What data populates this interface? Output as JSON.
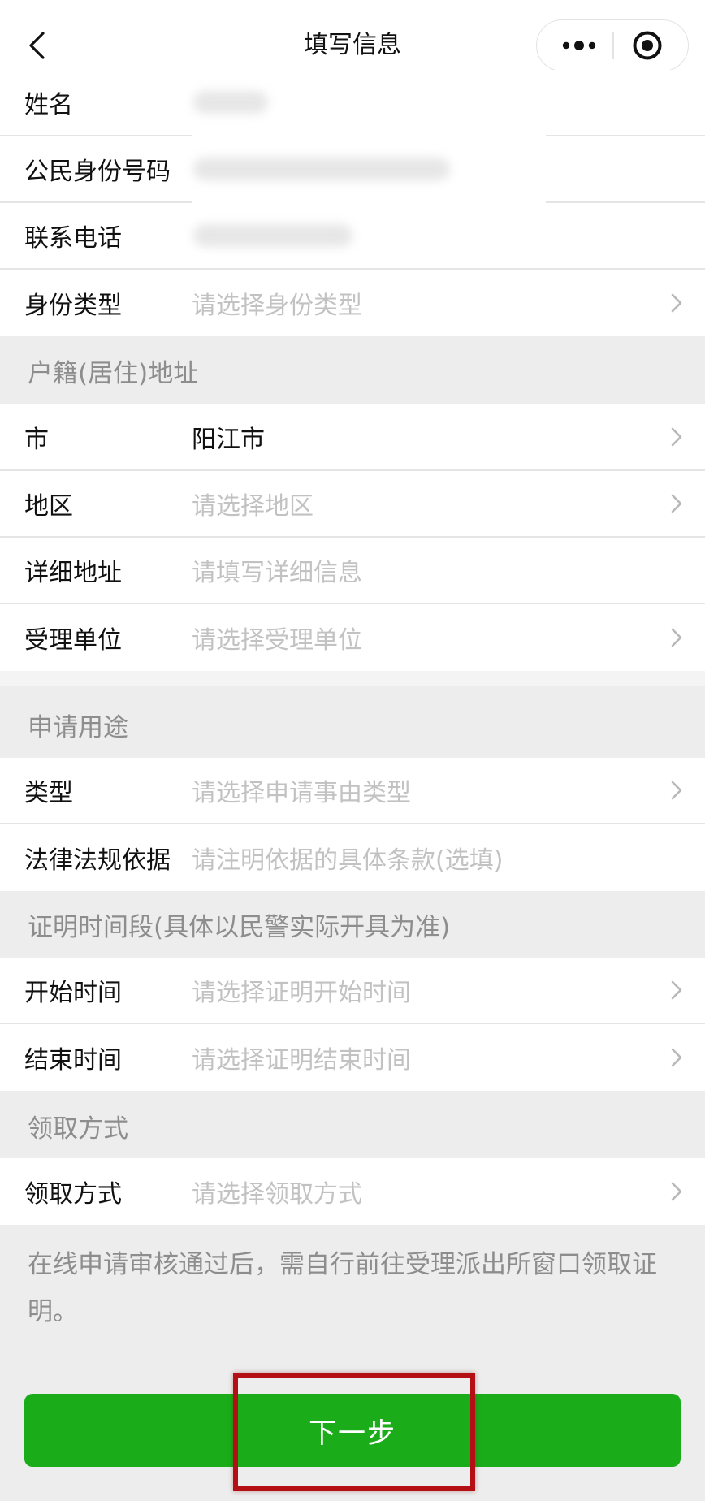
{
  "nav": {
    "title": "填写信息",
    "back_icon": "chevron-left-icon",
    "more_icon": "more-dots-icon",
    "close_icon": "target-circle-icon"
  },
  "personal": {
    "name_label": "姓名",
    "id_label": "公民身份号码",
    "phone_label": "联系电话",
    "identity_type_label": "身份类型",
    "identity_type_placeholder": "请选择身份类型"
  },
  "address": {
    "section_title": "户籍(居住)地址",
    "city_label": "市",
    "city_value": "阳江市",
    "district_label": "地区",
    "district_placeholder": "请选择地区",
    "detail_label": "详细地址",
    "detail_placeholder": "请填写详细信息",
    "office_label": "受理单位",
    "office_placeholder": "请选择受理单位"
  },
  "purpose": {
    "section_title": "申请用途",
    "type_label": "类型",
    "type_placeholder": "请选择申请事由类型",
    "law_label": "法律法规依据",
    "law_placeholder": "请注明依据的具体条款(选填)"
  },
  "period": {
    "section_title": "证明时间段(具体以民警实际开具为准)",
    "start_label": "开始时间",
    "start_placeholder": "请选择证明开始时间",
    "end_label": "结束时间",
    "end_placeholder": "请选择证明结束时间"
  },
  "pickup": {
    "section_title": "领取方式",
    "method_label": "领取方式",
    "method_placeholder": "请选择领取方式"
  },
  "notice": "在线申请审核通过后，需自行前往受理派出所窗口领取证明。",
  "next_button": "下一步",
  "colors": {
    "primary_button": "#1aad19",
    "highlight_box": "#b30f15",
    "background": "#ededed"
  }
}
